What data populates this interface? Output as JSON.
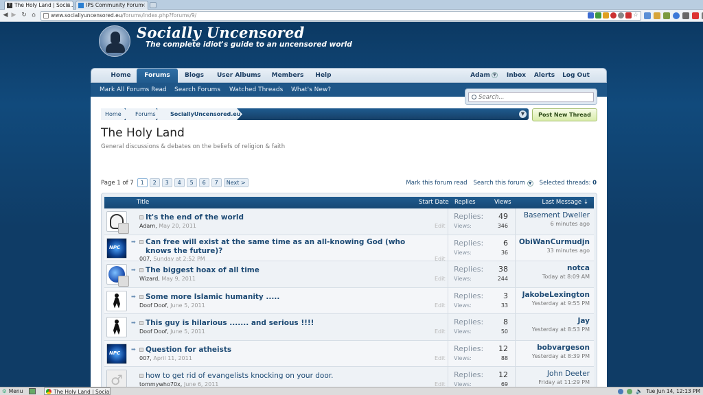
{
  "browser": {
    "tabs": [
      {
        "label": "The Holy Land | Socia...",
        "favicon": "?"
      },
      {
        "label": "IPS Community Forum",
        "favicon": ""
      }
    ],
    "url_host": "www.sociallyuncensored.eu",
    "url_path": "/forums/index.php?forums/9/"
  },
  "site": {
    "title": "Socially Uncensored",
    "tagline": "The complete idiot's guide to an uncensored world"
  },
  "nav": {
    "tabs": [
      "Home",
      "Forums",
      "Blogs",
      "User Albums",
      "Members",
      "Help"
    ],
    "user": "Adam",
    "inbox": "Inbox",
    "alerts": "Alerts",
    "logout": "Log Out",
    "sub": [
      "Mark All Forums Read",
      "Search Forums",
      "Watched Threads",
      "What's New?"
    ],
    "search_placeholder": "Search..."
  },
  "breadcrumb": [
    "Home",
    "Forums",
    "SociallyUncensored.eu"
  ],
  "post_thread": "Post New Thread",
  "forum": {
    "title": "The Holy Land",
    "description": "General discussions & debates on the beliefs of religion & faith",
    "page_label": "Page 1 of 7",
    "pages": [
      "1",
      "2",
      "3",
      "4",
      "5",
      "6",
      "7"
    ],
    "next": "Next >",
    "mark_read": "Mark this forum read",
    "search_forum": "Search this forum",
    "selected_label": "Selected threads:",
    "selected_count": "0"
  },
  "table": {
    "headers": {
      "title": "Title",
      "start_date": "Start Date",
      "replies": "Replies",
      "views": "Views",
      "last_message": "Last Message ↓"
    },
    "replies_label": "Replies:",
    "views_label": "Views:",
    "edit_label": "Edit",
    "threads": [
      {
        "title": "It's the end of the world",
        "author": "Adam",
        "date": "May 20, 2011",
        "replies": "49",
        "views": "346",
        "last_user": "Basement Dweller",
        "last_time": "6 minutes ago",
        "avatar": "face",
        "new": false
      },
      {
        "title": "Can free will exist at the same time as an all-knowing God (who knows the future)?",
        "author": "007",
        "date": "Sunday at 2:52 PM",
        "replies": "6",
        "views": "36",
        "last_user": "ObiWanCurmudjn",
        "last_time": "33 minutes ago",
        "avatar": "npc",
        "new": true
      },
      {
        "title": "The biggest hoax of all time",
        "author": "Wizard",
        "date": "May 9, 2011",
        "replies": "38",
        "views": "244",
        "last_user": "notca",
        "last_time": "Today at 8:09 AM",
        "avatar": "globe",
        "new": true
      },
      {
        "title": "Some more Islamic humanity .....",
        "author": "Doof Doof",
        "date": "June 5, 2011",
        "replies": "3",
        "views": "33",
        "last_user": "JakobeLexington",
        "last_time": "Yesterday at 9:55 PM",
        "avatar": "banksy",
        "new": true
      },
      {
        "title": "This guy is hilarious ....... and serious !!!!",
        "author": "Doof Doof",
        "date": "June 5, 2011",
        "replies": "8",
        "views": "50",
        "last_user": "Jay",
        "last_time": "Yesterday at 8:53 PM",
        "avatar": "banksy",
        "new": true
      },
      {
        "title": "Question for atheists",
        "author": "007",
        "date": "April 11, 2011",
        "replies": "12",
        "views": "88",
        "last_user": "bobvargeson",
        "last_time": "Yesterday at 8:39 PM",
        "avatar": "npc",
        "new": true
      },
      {
        "title": "how to get rid of evangelists knocking on your door.",
        "author": "tommywho70x",
        "date": "June 6, 2011",
        "replies": "12",
        "views": "69",
        "last_user": "John Deeter",
        "last_time": "Friday at 11:29 PM",
        "avatar": "male",
        "new": false
      }
    ]
  },
  "taskbar": {
    "menu": "Menu",
    "task": "The Holy Land | Sociall...",
    "clock": "Tue Jun 14, 12:13 PM"
  }
}
